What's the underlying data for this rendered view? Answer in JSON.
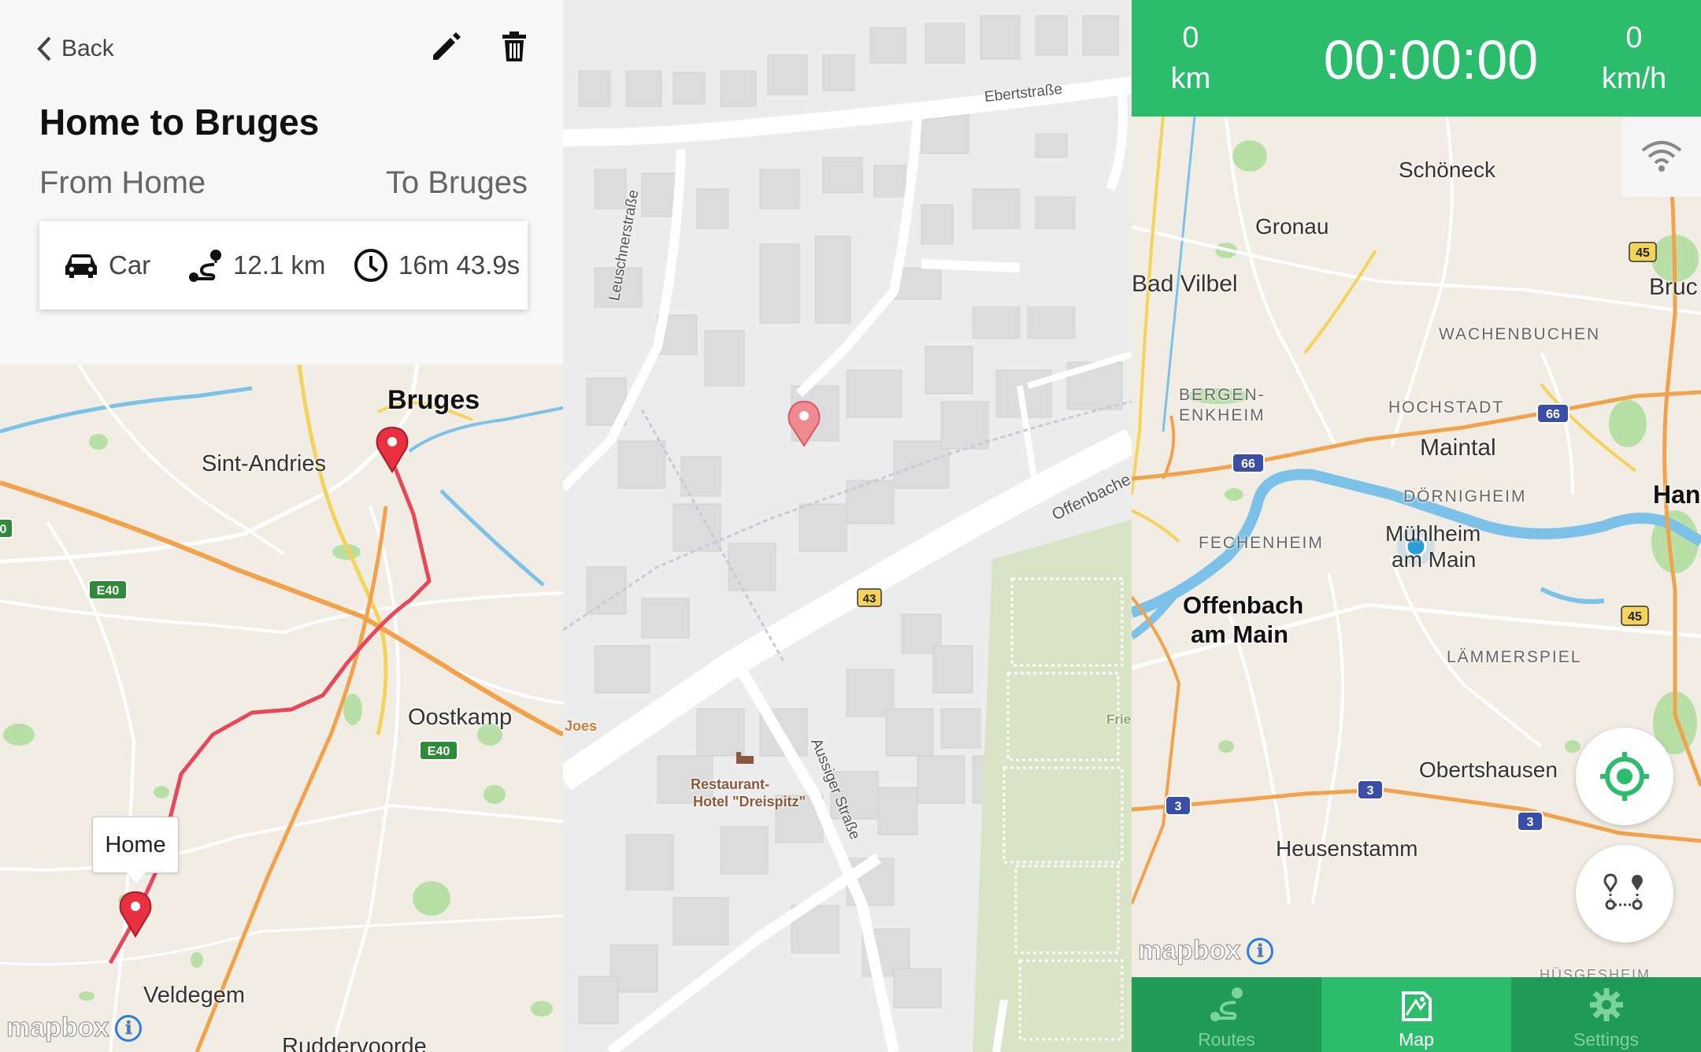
{
  "left_panel": {
    "back_label": "Back",
    "route_title": "Home to Bruges",
    "from_label": "From Home",
    "to_label": "To Bruges",
    "stats": {
      "mode": "Car",
      "distance": "12.1 km",
      "duration": "16m 43.9s"
    },
    "map": {
      "labels": {
        "bruges": "Bruges",
        "sint_andries": "Sint-Andries",
        "oostkamp": "Oostkamp",
        "veldegem": "Veldegem",
        "ruddervoorde": "Ruddervoorde"
      },
      "shields": {
        "e40_a": "E40",
        "e40_b": "E40",
        "edge": "0"
      },
      "start_callout": "Home",
      "attribution": "mapbox",
      "route_color": "#e8475a"
    }
  },
  "middle_panel": {
    "streets": {
      "ebertstrasse": "Ebertstraße",
      "leuschnerstrasse": "Leuschnerstraße",
      "offenbacher": "Offenbache",
      "aussiger_strasse": "Aussiger Straße"
    },
    "road_shield": "43",
    "poi": {
      "name_line1": "Restaurant-",
      "name_line2": "Hotel \"Dreispitz\""
    },
    "edge_labels": {
      "joes": "Joes",
      "frie": "Frie"
    }
  },
  "right_panel": {
    "tracker": {
      "distance_value": "0",
      "distance_unit": "km",
      "time": "00:00:00",
      "speed_value": "0",
      "speed_unit": "km/h"
    },
    "map": {
      "labels": {
        "schoneck": "Schöneck",
        "gronau": "Gronau",
        "bad_vilbel": "Bad Vilbel",
        "bruch": "Bruc",
        "wachenbuchen": "WACHENBUCHEN",
        "bergen1": "BERGEN-",
        "bergen2": "ENKHEIM",
        "hochstadt": "HOCHSTADT",
        "maintal": "Maintal",
        "dornigheim": "DÖRNIGHEIM",
        "hanau": "Hana",
        "fechenheim": "FECHENHEIM",
        "muhlheim1": "Mühlheim",
        "muhlheim2": "am Main",
        "offenbach1": "Offenbach",
        "offenbach2": "am Main",
        "lammerspiel": "LÄMMERSPIEL",
        "obertshausen": "Obertshausen",
        "heusenstamm": "Heusenstamm",
        "bottom_edge": "HÜSGESHEIM"
      },
      "shields": [
        "45",
        "66",
        "66",
        "45",
        "3",
        "3",
        "3"
      ],
      "attribution": "mapbox"
    },
    "nav": {
      "routes": "Routes",
      "map": "Map",
      "settings": "Settings"
    },
    "colors": {
      "brand_green": "#2bbc6c",
      "nav_green": "#1f9a57"
    }
  }
}
